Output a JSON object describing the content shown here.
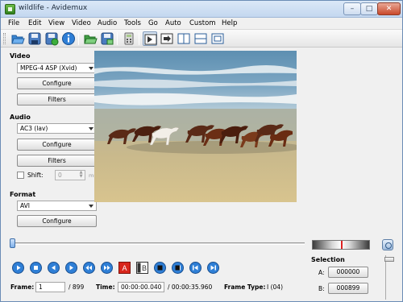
{
  "window": {
    "title": "wildlife - Avidemux",
    "min": "–",
    "max": "□",
    "close": "✕"
  },
  "menu": [
    "File",
    "Edit",
    "View",
    "Video",
    "Audio",
    "Tools",
    "Go",
    "Auto",
    "Custom",
    "Help"
  ],
  "toolbar": {
    "buttons": [
      "open-icon",
      "save-icon",
      "save-project-icon",
      "info-icon",
      "open-image-icon",
      "save-image-icon",
      "calculator-icon",
      "input-view-icon",
      "output-view-icon",
      "side-by-side-icon",
      "top-bottom-icon",
      "preview-icon"
    ]
  },
  "video": {
    "label": "Video",
    "codec": "MPEG-4 ASP (Xvid)",
    "configure": "Configure",
    "filters": "Filters"
  },
  "audio": {
    "label": "Audio",
    "codec": "AC3 (lav)",
    "configure": "Configure",
    "filters": "Filters",
    "shift_label": "Shift:",
    "shift_value": "0",
    "shift_unit": "ms"
  },
  "format": {
    "label": "Format",
    "container": "AVI",
    "configure": "Configure"
  },
  "navigation": {
    "buttons": [
      "play-icon",
      "stop-icon",
      "previous-frame-icon",
      "next-frame-icon",
      "previous-keyframe-icon",
      "next-keyframe-icon",
      "set-marker-a-icon",
      "set-marker-b-icon",
      "previous-black-frame-icon",
      "next-black-frame-icon",
      "go-to-start-icon",
      "go-to-end-icon"
    ]
  },
  "status": {
    "frame_label": "Frame:",
    "frame_value": "1",
    "frame_total": "/ 899",
    "time_label": "Time:",
    "time_value": "00:00:00.040",
    "time_total": "/ 00:00:35.960",
    "frame_type_label": "Frame Type:",
    "frame_type_value": "I (04)"
  },
  "selection": {
    "title": "Selection",
    "a_label": "A:",
    "a_value": "000000",
    "b_label": "B:",
    "b_value": "000899"
  },
  "colors": {
    "nav_button": "#2f7fd6",
    "marker_red": "#d8261c",
    "title_bar": "#c3d7ef"
  }
}
